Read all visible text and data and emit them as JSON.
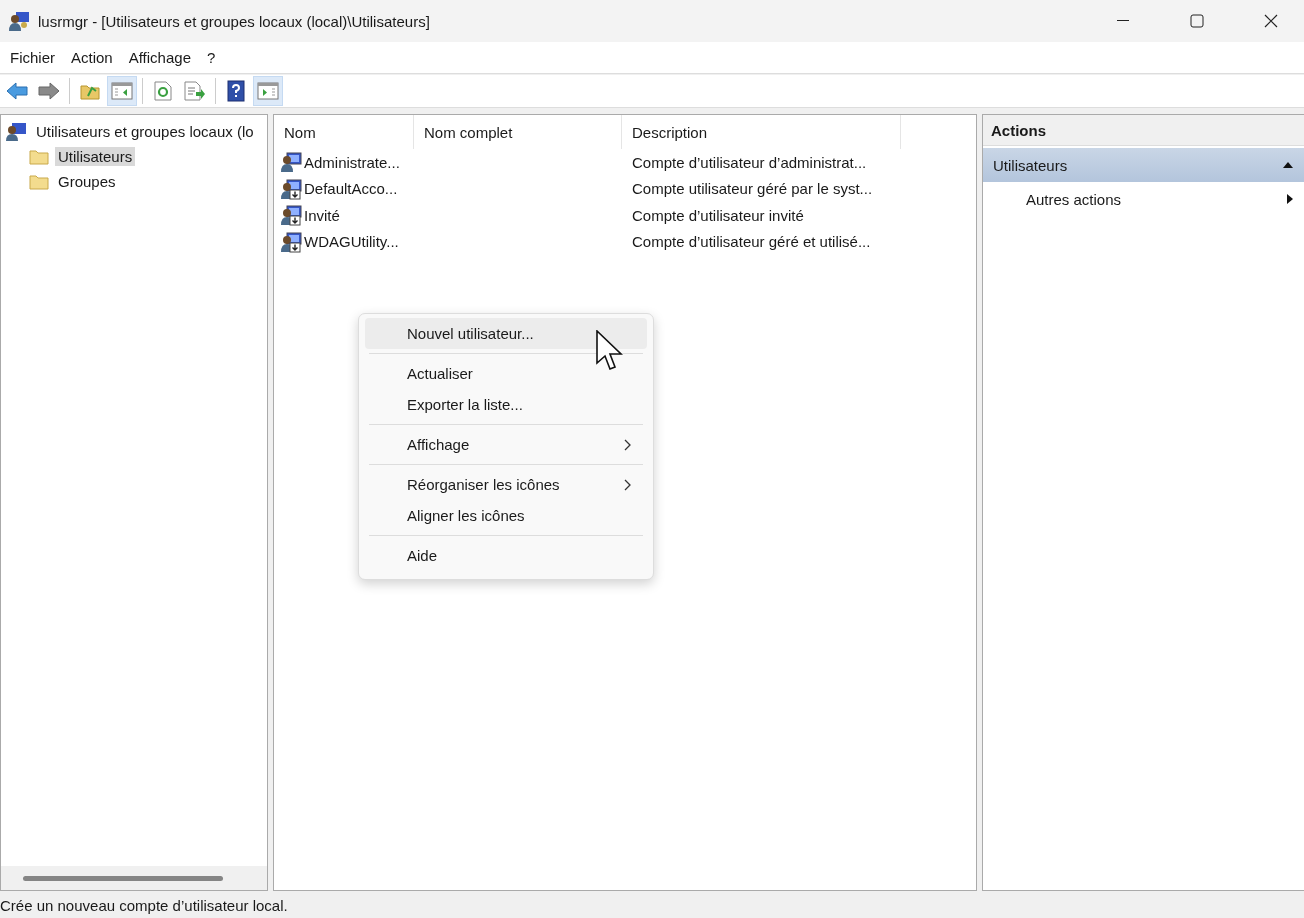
{
  "window": {
    "title": "lusrmgr - [Utilisateurs et groupes locaux (local)\\Utilisateurs]"
  },
  "menu_bar": [
    "Fichier",
    "Action",
    "Affichage",
    "?"
  ],
  "toolbar": [
    [
      {
        "kind": "back",
        "pressed": false
      },
      {
        "kind": "forward",
        "pressed": false
      }
    ],
    [
      {
        "kind": "up",
        "pressed": false
      },
      {
        "kind": "tree",
        "pressed": true
      }
    ],
    [
      {
        "kind": "refresh",
        "pressed": false
      },
      {
        "kind": "export",
        "pressed": false
      }
    ],
    [
      {
        "kind": "help",
        "pressed": false
      },
      {
        "kind": "actionpane",
        "pressed": true
      }
    ]
  ],
  "tree": {
    "label": "Utilisateurs et groupes locaux (lo",
    "selected": false,
    "children": [
      {
        "label": "Utilisateurs",
        "selected": true
      },
      {
        "label": "Groupes",
        "selected": false
      }
    ]
  },
  "table": {
    "columns": [
      "Nom",
      "Nom complet",
      "Description"
    ],
    "rows": [
      {
        "name": "Administrate...",
        "description": "Compte d’utilisateur d’administrat...",
        "disabled": false
      },
      {
        "name": "DefaultAcco...",
        "description": "Compte utilisateur géré par le syst...",
        "disabled": true
      },
      {
        "name": "Invité",
        "description": "Compte d’utilisateur invité",
        "disabled": true
      },
      {
        "name": "WDAGUtility...",
        "description": "Compte d’utilisateur géré et utilisé...",
        "disabled": true
      }
    ]
  },
  "context_menu": [
    [
      {
        "label": "Nouvel utilisateur...",
        "submenu": false,
        "selected": true
      }
    ],
    [
      {
        "label": "Actualiser",
        "submenu": false,
        "selected": false
      },
      {
        "label": "Exporter la liste...",
        "submenu": false,
        "selected": false
      }
    ],
    [
      {
        "label": "Affichage",
        "submenu": true,
        "selected": false
      }
    ],
    [
      {
        "label": "Réorganiser les icônes",
        "submenu": true,
        "selected": false
      },
      {
        "label": "Aligner les icônes",
        "submenu": false,
        "selected": false
      }
    ],
    [
      {
        "label": "Aide",
        "submenu": false,
        "selected": false
      }
    ]
  ],
  "actions_pane": {
    "title": "Actions",
    "sections": [
      {
        "label": "Utilisateurs",
        "expanded": true,
        "items": [
          {
            "label": "Autres actions",
            "submenu": true
          }
        ]
      }
    ]
  },
  "status_bar": "Crée un nouveau compte d’utilisateur local."
}
